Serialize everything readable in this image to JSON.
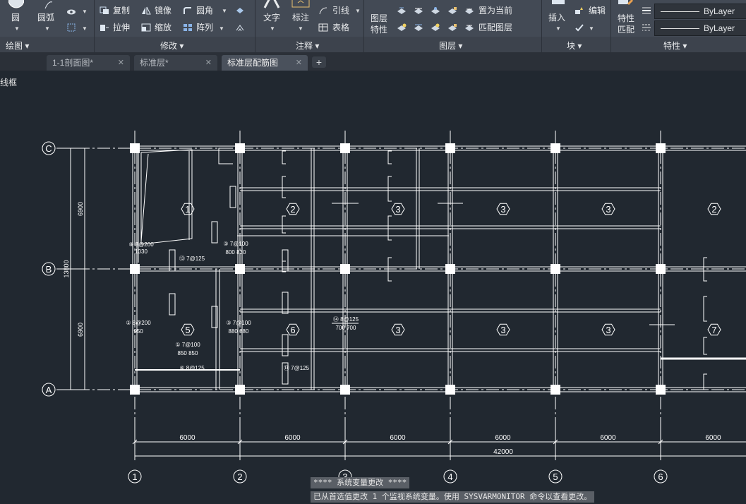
{
  "ribbon": {
    "draw_panel": {
      "title": "绘图",
      "arc": "圆弧",
      "circle": "圆"
    },
    "modify_panel": {
      "title": "修改",
      "copy": "复制",
      "mirror": "镜像",
      "fillet": "圆角",
      "stretch": "拉伸",
      "scale": "缩放",
      "array": "阵列"
    },
    "annotation_panel": {
      "title": "注释",
      "text": "文字",
      "dimension": "标注",
      "leader": "引线",
      "table": "表格"
    },
    "layers_panel": {
      "title": "图层",
      "layer_properties_1": "图层",
      "layer_properties_2": "特性",
      "set_current": "置为当前",
      "match_layer": "匹配图层"
    },
    "block_panel": {
      "title": "块",
      "insert": "插入",
      "edit": "编辑"
    },
    "properties_panel": {
      "title": "特性",
      "match_1": "特性",
      "match_2": "匹配",
      "color": "ByLayer",
      "linetype": "ByLayer"
    }
  },
  "tabs": [
    {
      "label": "1-1剖面图*",
      "close": "✕",
      "active": false
    },
    {
      "label": "标准层*",
      "close": "✕",
      "active": false
    },
    {
      "label": "标准层配筋图",
      "close": "✕",
      "active": true
    }
  ],
  "tab_add": "+",
  "viewport_label": "线框",
  "drawing": {
    "grid_rows": [
      "C",
      "B",
      "A"
    ],
    "grid_cols": [
      "1",
      "2",
      "3",
      "4",
      "5",
      "6"
    ],
    "bay_dims": [
      "6000",
      "6000",
      "6000",
      "6000",
      "6000",
      "6000"
    ],
    "total_dim": "42000",
    "row_dims": [
      "6900",
      "6900"
    ],
    "total_row_dim": "13800",
    "slab_labels_top": [
      "1",
      "2",
      "3",
      "3",
      "3",
      "2"
    ],
    "slab_labels_bottom": [
      "5",
      "6",
      "3",
      "3",
      "3",
      "7"
    ],
    "rebar_notes": [
      {
        "text": "⑧ 8@200",
        "area": "bay1"
      },
      {
        "text": "1030",
        "area": "bay1"
      },
      {
        "text": "⑬ 7@125",
        "area": "bay1"
      },
      {
        "text": "② 8@200",
        "area": "bay1b"
      },
      {
        "text": "950",
        "area": "bay1b"
      },
      {
        "text": "① 7@100",
        "area": "bay1b"
      },
      {
        "text": "850 850",
        "area": "bay1b"
      },
      {
        "text": "⑥ 8@125",
        "area": "bay1b"
      },
      {
        "text": "③ 7@100",
        "area": "bay2"
      },
      {
        "text": "880 880",
        "area": "bay2"
      },
      {
        "text": "③ 7@100",
        "area": "bay2t"
      },
      {
        "text": "800 830",
        "area": "bay2t"
      },
      {
        "text": "⑬ 7@125",
        "area": "bay2b"
      },
      {
        "text": "⑭ 8@125",
        "area": "bay3"
      },
      {
        "text": "700 700",
        "area": "bay3"
      }
    ]
  },
  "command_line": {
    "line1": "**** 系统变量更改 ****",
    "line2": "已从首选值更改 1 个监视系统变量。使用 SYSVARMONITOR 命令以查看更改。"
  },
  "colors": {
    "canvas": "#212830",
    "ribbon": "#434a55",
    "line": "#ffffff"
  }
}
